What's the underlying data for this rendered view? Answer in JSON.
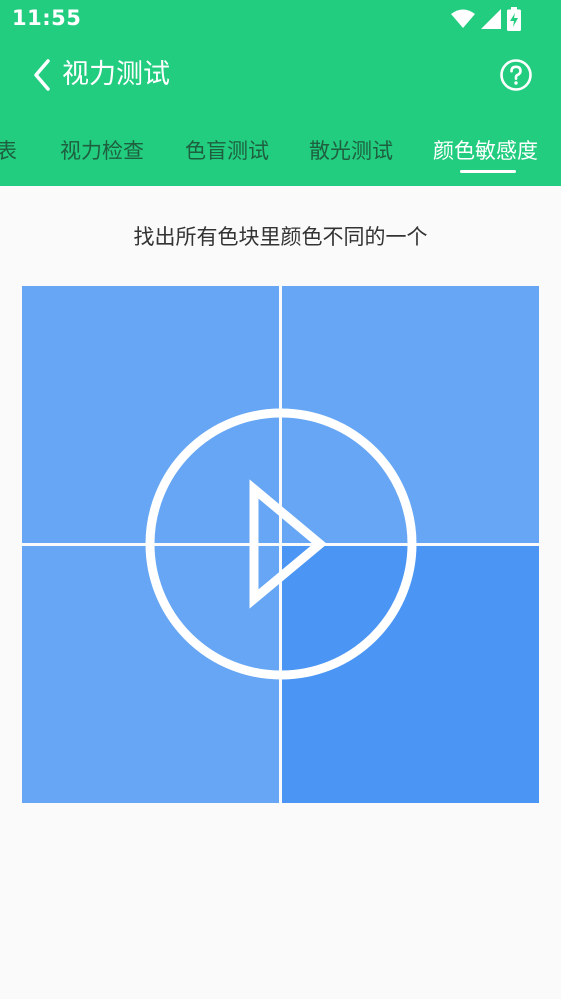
{
  "status_bar": {
    "time": "11:55"
  },
  "toolbar": {
    "title": "视力测试"
  },
  "tabs": [
    {
      "label": "表"
    },
    {
      "label": "视力检查"
    },
    {
      "label": "色盲测试"
    },
    {
      "label": "散光测试"
    },
    {
      "label": "颜色敏感度"
    }
  ],
  "active_tab_index": 4,
  "instruction": "找出所有色块里颜色不同的一个",
  "colors": {
    "header_green": "#22cd7f",
    "tab_inactive_text": "#1e5f3f",
    "block_normal": "#66a6f4",
    "block_different": "#4b95f4",
    "background": "#fafafa"
  },
  "grid": {
    "rows": 2,
    "cols": 2,
    "different_index": 3
  }
}
